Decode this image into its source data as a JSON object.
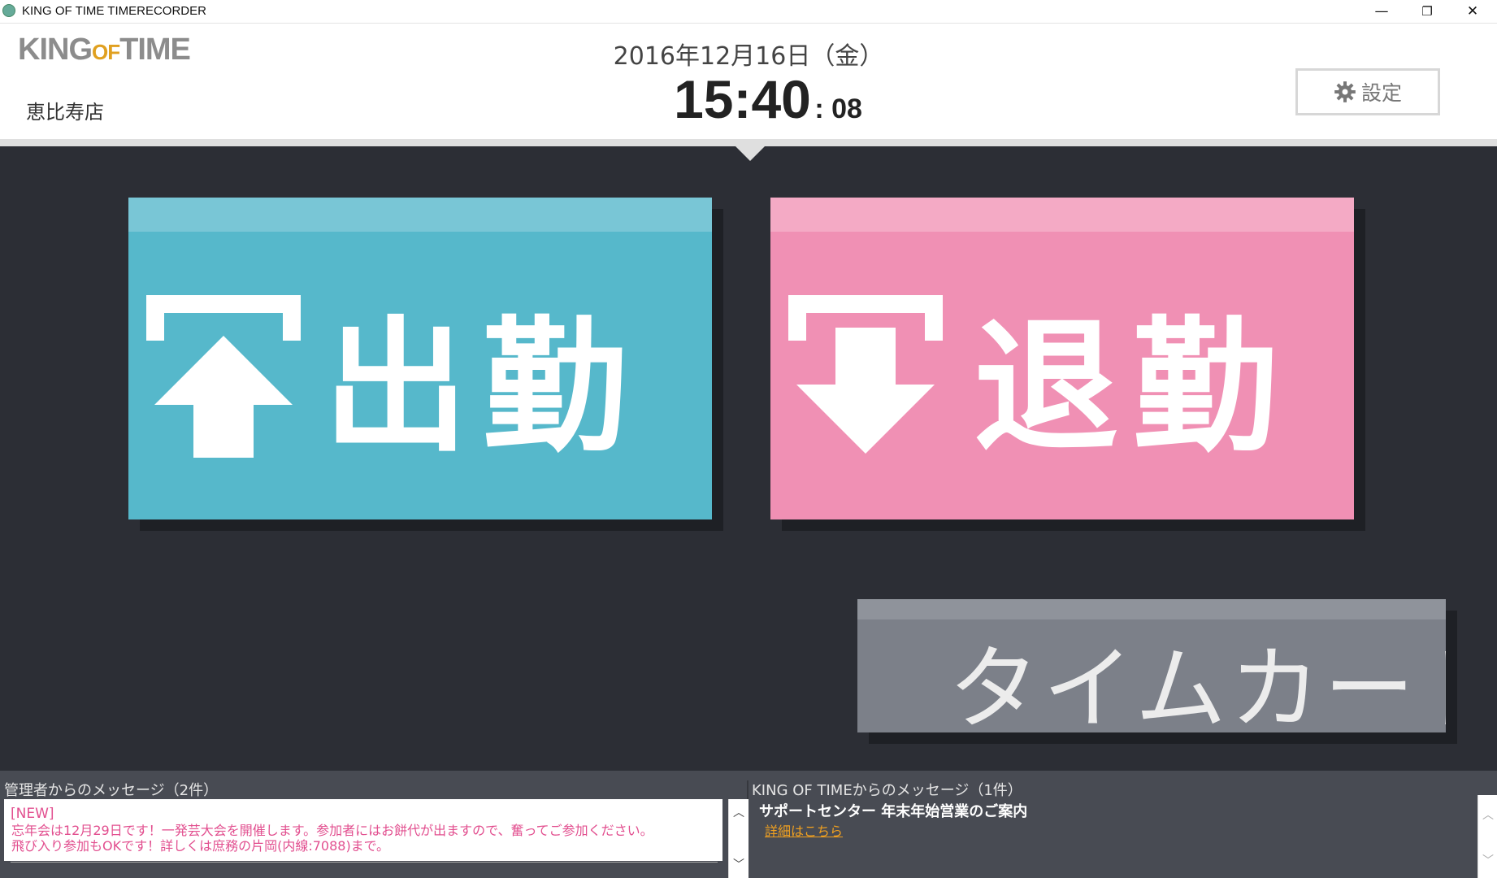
{
  "window": {
    "title": "KING OF TIME TIMERECORDER",
    "minimize": "—",
    "restore": "❐",
    "close": "✕"
  },
  "header": {
    "logo_king": "KING",
    "logo_of": "OF",
    "logo_time": "TIME",
    "store_name": "恵比寿店",
    "date": "2016年12月16日（金）",
    "time_hm": "15:40",
    "time_sec": ": 08",
    "settings_label": "設定"
  },
  "buttons": {
    "clock_in": "出勤",
    "clock_out": "退勤",
    "timecard": "タイムカード"
  },
  "admin_messages": {
    "title": "管理者からのメッセージ（2件）",
    "new_tag": "[NEW]",
    "line1": "忘年会は12月29日です！一発芸大会を開催します。参加者にはお餅代が出ますので、奮ってご参加ください。",
    "line2": "飛び入り参加もOKです！詳しくは庶務の片岡(内線:7088)まで。"
  },
  "kot_messages": {
    "title": "KING OF TIMEからのメッセージ（1件）",
    "headline": "サポートセンター 年末年始営業のご案内",
    "link": "詳細はこちら"
  },
  "colors": {
    "clock_in": "#56b8cb",
    "clock_out": "#f090b4",
    "timecard": "#7c8089",
    "background": "#2c2e35"
  }
}
